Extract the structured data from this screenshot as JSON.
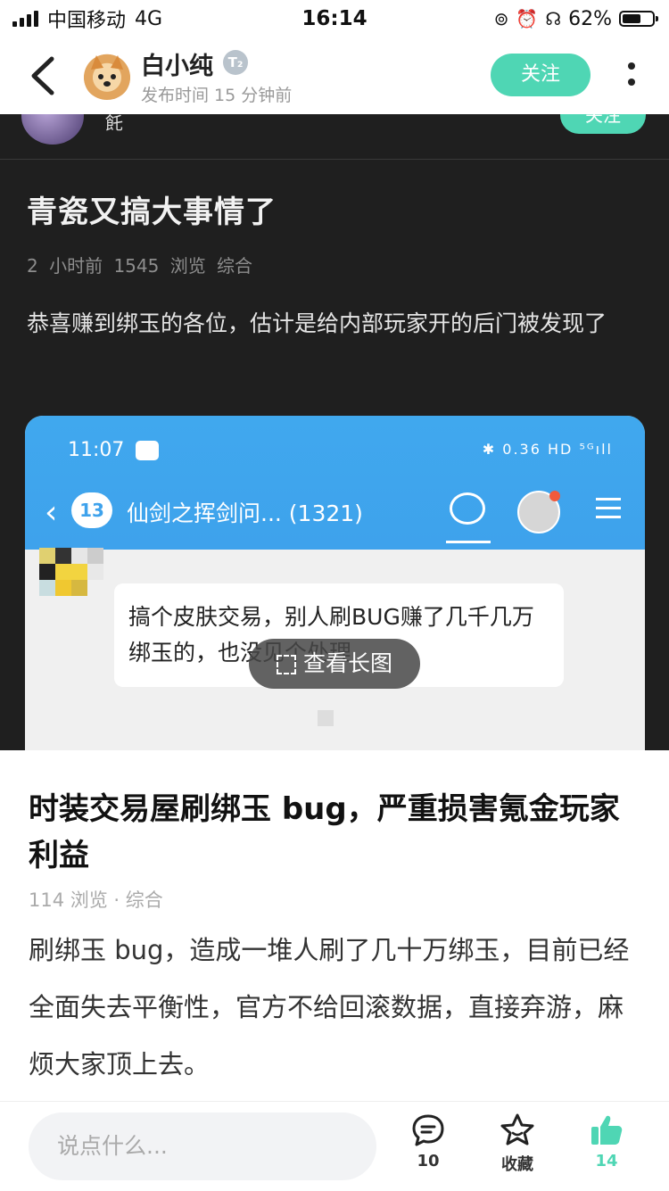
{
  "status_bar": {
    "carrier": "中国移动",
    "network": "4G",
    "time": "16:14",
    "battery_percent": "62%",
    "battery_level": 0.62
  },
  "header": {
    "author_name": "白小纯",
    "badge": "T₂",
    "publish_time": "发布时间 15 分钟前",
    "follow_label": "关注"
  },
  "shared_post": {
    "author_name_partial": "飥",
    "follow_label": "关注",
    "title": "青瓷又搞大事情了",
    "meta": "2 小时前  1545 浏览  综合",
    "body": "恭喜赚到绑玉的各位，估计是给内部玩家开的后门被发现了",
    "screenshot": {
      "time": "11:07",
      "status_icons": "✱ 0.36 HD ⁵ᴳıll",
      "unread_count": "13",
      "group_name": "仙剑之挥剑问... (1321)",
      "message": "搞个皮肤交易，别人刷BUG赚了几千几万绑玉的，也没见个处理",
      "view_long_image": "查看长图"
    }
  },
  "article": {
    "title": "时装交易屋刷绑玉 bug，严重损害氪金玩家利益",
    "meta": "114 浏览 · 综合",
    "body": "刷绑玉 bug，造成一堆人刷了几十万绑玉，目前已经全面失去平衡性，官方不给回滚数据，直接弃游，麻烦大家顶上去。"
  },
  "bottom_bar": {
    "comment_placeholder": "说点什么...",
    "comment_count": "10",
    "favorite_label": "收藏",
    "like_count": "14"
  },
  "colors": {
    "accent": "#4fd6b4",
    "dark_bg": "#1f1f1f",
    "screenshot_blue": "#3ea2ec"
  }
}
